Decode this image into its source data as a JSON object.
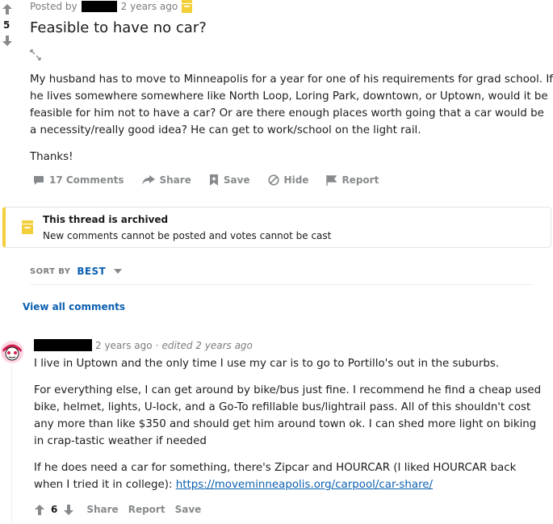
{
  "post": {
    "score": "5",
    "posted_by": "Posted by",
    "age": "2 years ago",
    "title": "Feasible to have no car?",
    "body_p1": "My husband has to move to Minneapolis for a year for one of his requirements for grad school. If he lives somewhere somewhere like North Loop, Loring Park, downtown, or Uptown, would it be feasible for him not to have a car? Or are there enough places worth going that a car would be a necessity/really good idea? He can get to work/school on the light rail.",
    "body_p2": "Thanks!",
    "actions": {
      "comments": "17 Comments",
      "share": "Share",
      "save": "Save",
      "hide": "Hide",
      "report": "Report"
    }
  },
  "archived": {
    "title": "This thread is archived",
    "message": "New comments cannot be posted and votes cannot be cast"
  },
  "sort": {
    "label": "SORT BY",
    "value": "BEST"
  },
  "view_all": "View all comments",
  "comment": {
    "age": "2 years ago",
    "separator": "·",
    "edited": "edited 2 years ago",
    "p1": "I live in Uptown and the only time I use my car is to go to Portillo's out in the suburbs.",
    "p2": "For everything else, I can get around by bike/bus just fine. I recommend he find a cheap used bike, helmet, lights, U-lock, and a Go-To refillable bus/lightrail pass. All of this shouldn't cost any more than like $350 and should get him around town ok. I can shed more light on biking in crap-tastic weather if needed",
    "p3": "If he does need a car for something, there's Zipcar and HOURCAR (I liked HOURCAR back when I tried it in college):",
    "link": "https://moveminneapolis.org/carpool/car-share/",
    "score": "6",
    "share": "Share",
    "report": "Report",
    "save": "Save"
  },
  "colors": {
    "accent": "#0b5fb0",
    "archived_yellow": "#f2cf3b",
    "muted": "#878a8c"
  }
}
